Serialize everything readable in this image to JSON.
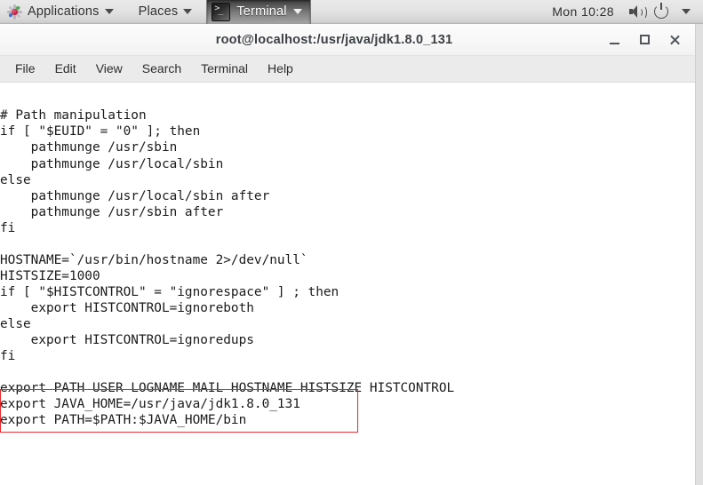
{
  "panel": {
    "applications": {
      "label": "Applications",
      "icon": "applications-launcher-icon",
      "caret": "chevron-down-icon"
    },
    "places": {
      "label": "Places",
      "caret": "chevron-down-icon"
    },
    "window_list": {
      "label": "Terminal",
      "icon": "terminal-icon",
      "caret": "chevron-down-icon",
      "active": true
    },
    "clock": "Mon 10:28",
    "tray": [
      {
        "name": "volume-icon",
        "label": "Volume"
      },
      {
        "name": "power-icon",
        "label": "System"
      },
      {
        "name": "chevron-down-icon",
        "label": "System menu"
      }
    ]
  },
  "window": {
    "title": "root@localhost:/usr/java/jdk1.8.0_131",
    "controls": {
      "minimize": "Minimize",
      "maximize": "Maximize",
      "close": "Close"
    },
    "menu": [
      "File",
      "Edit",
      "View",
      "Search",
      "Terminal",
      "Help"
    ]
  },
  "terminal": {
    "content": "# Path manipulation\nif [ \"$EUID\" = \"0\" ]; then\n    pathmunge /usr/sbin\n    pathmunge /usr/local/sbin\nelse\n    pathmunge /usr/local/sbin after\n    pathmunge /usr/sbin after\nfi\n\nHOSTNAME=`/usr/bin/hostname 2>/dev/null`\nHISTSIZE=1000\nif [ \"$HISTCONTROL\" = \"ignorespace\" ] ; then\n    export HISTCONTROL=ignoreboth\nelse\n    export HISTCONTROL=ignoredups\nfi\n\nexport PATH USER LOGNAME MAIL HOSTNAME HISTSIZE HISTCONTROL\nexport JAVA_HOME=/usr/java/jdk1.8.0_131\nexport PATH=$PATH:$JAVA_HOME/bin",
    "lines": [
      "# Path manipulation",
      "if [ \"$EUID\" = \"0\" ]; then",
      "    pathmunge /usr/sbin",
      "    pathmunge /usr/local/sbin",
      "else",
      "    pathmunge /usr/local/sbin after",
      "    pathmunge /usr/sbin after",
      "fi",
      "",
      "HOSTNAME=`/usr/bin/hostname 2>/dev/null`",
      "HISTSIZE=1000",
      "if [ \"$HISTCONTROL\" = \"ignorespace\" ] ; then",
      "    export HISTCONTROL=ignoreboth",
      "else",
      "    export HISTCONTROL=ignoredups",
      "fi",
      "",
      "export PATH USER LOGNAME MAIL HOSTNAME HISTSIZE HISTCONTROL",
      "export JAVA_HOME=/usr/java/jdk1.8.0_131",
      "export PATH=$PATH:$JAVA_HOME/bin"
    ],
    "highlighted_lines": [
      "export JAVA_HOME=/usr/java/jdk1.8.0_131",
      "export PATH=$PATH:$JAVA_HOME/bin"
    ]
  },
  "colors": {
    "annotation": "#e8292c",
    "panel_bg": "#e3e3e3",
    "terminal_bg": "#ffffff",
    "terminal_fg": "#1b1b1b"
  }
}
